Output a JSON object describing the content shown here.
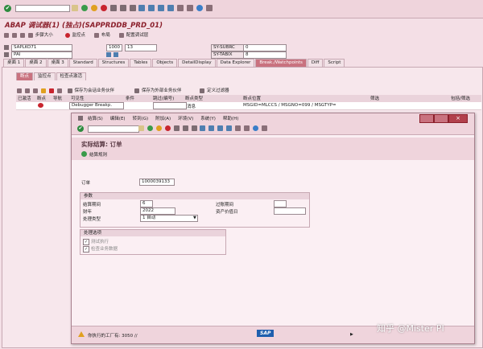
{
  "window_title": "ABAP 调试器(1) (独占)(SAPPRDDB_PRD_01)",
  "debug_toolbar": [
    "步骤大小",
    "监控点",
    "布局",
    "配置调试层"
  ],
  "fields": {
    "program": "SAPLKO71",
    "line_no": "1000",
    "line_total": "13",
    "module": "PAI",
    "sysubrc_label": "SY-SUBRC",
    "sysubrc_value": "0",
    "sytabix_label": "SY-TABIX",
    "sytabix_value": "8"
  },
  "main_tabs": [
    "桌面 1",
    "桌面 2",
    "桌面 3",
    "Standard",
    "Structures",
    "Tables",
    "Objects",
    "DetailDisplay",
    "Data Explorer",
    "Break./Watchpoints",
    "Diff",
    "Script"
  ],
  "sub_tabs": [
    "断点",
    "监控点",
    "检查点激活"
  ],
  "bp_toolbar": [
    "保存为会话业务伙伴",
    "保存为外部业务伙伴",
    "定义过滤器"
  ],
  "grid_headers": [
    "已激活",
    "断点",
    "导航",
    "可见性",
    "条件",
    "跳过(编号)",
    "断点类型",
    "断点位置",
    "筛选",
    "包括/筛选"
  ],
  "grid_row": {
    "visibility": "Debugger Breakp.",
    "type": "消息",
    "position": "MSGID=MLCCS / MSGNO=099 / MSGTYP="
  },
  "dialog": {
    "menu": [
      "结算(S)",
      "编辑(E)",
      "转到(G)",
      "附加(A)",
      "环境(V)",
      "系统(Y)",
      "帮助(H)"
    ],
    "title": "实际结算: 订单",
    "action": "结算规则",
    "order_label": "订单",
    "order_value": "1000039133",
    "params_title": "参数",
    "period_label": "结算期间",
    "period_value": "6",
    "year_label": "财年",
    "year_value": "2022",
    "proc_label": "处理类型",
    "proc_value": "1 自动",
    "transfer_label": "过账期间",
    "transfer_value": "",
    "asset_label": "资产价值日",
    "asset_value": "",
    "options_title": "处理选项",
    "opt1": "测试执行",
    "opt2": "检查业务数据",
    "status": "你执行的工厂有: 3050 //",
    "sap_logo": "SAP"
  },
  "watermark": "知乎 @Mister PI",
  "colors": {
    "accent": "#c9727f",
    "title_red": "#8b1f2b",
    "body_bg": "#f4dfe6"
  }
}
